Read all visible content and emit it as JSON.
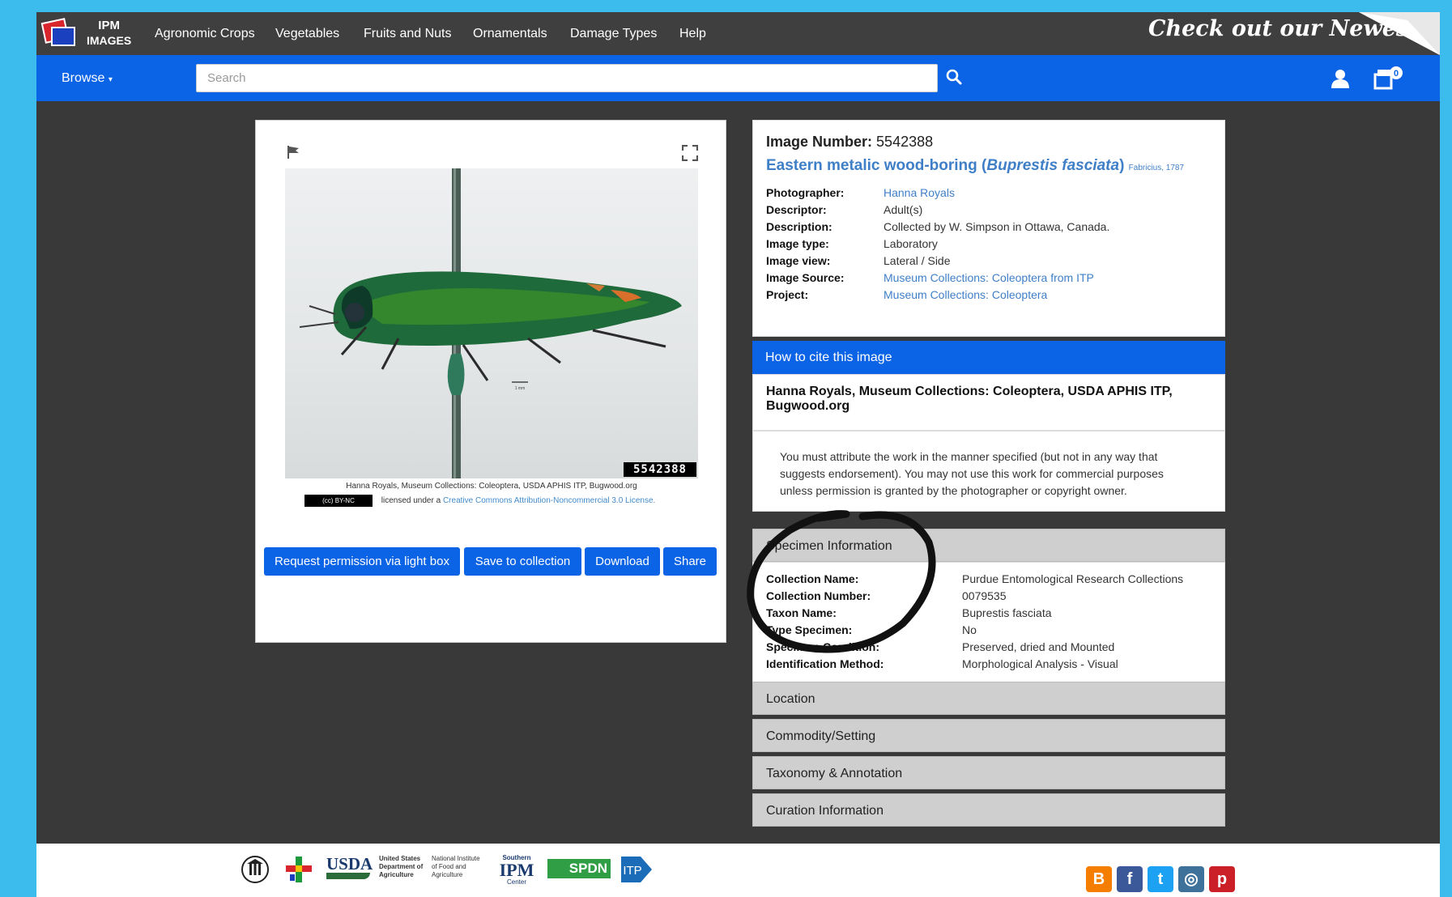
{
  "nav": {
    "logo_line1": "IPM",
    "logo_line2": "IMAGES",
    "links": [
      "Agronomic Crops",
      "Vegetables",
      "Fruits and Nuts",
      "Ornamentals",
      "Damage Types",
      "Help"
    ],
    "features_banner": "Check out our Newest Features"
  },
  "searchbar": {
    "browse_label": "Browse",
    "placeholder": "Search",
    "cart_count": "0"
  },
  "image": {
    "number_overlay": "5542388",
    "caption": "Hanna Royals, Museum Collections: Coleoptera, USDA APHIS ITP, Bugwood.org",
    "license_badge": "(cc) BY-NC",
    "license_prefix": "licensed under a",
    "license_link": "Creative Commons Attribution-Noncommercial 3.0 License.",
    "scale_label": "1 mm"
  },
  "actions": {
    "request": "Request permission via light box",
    "save": "Save to collection",
    "download": "Download",
    "share": "Share"
  },
  "info": {
    "number_label": "Image Number:",
    "number": "5542388",
    "title_common": "Eastern metalic wood-boring (",
    "title_sci": "Buprestis fasciata",
    "title_close": ")",
    "title_author": "Fabricius, 1787",
    "rows": [
      {
        "k": "Photographer:",
        "v": "Hanna Royals"
      },
      {
        "k": "Descriptor:",
        "v": "Adult(s)"
      },
      {
        "k": "Description:",
        "v": "Collected by W. Simpson in Ottawa, Canada."
      },
      {
        "k": "Image type:",
        "v": "Laboratory"
      },
      {
        "k": "Image view:",
        "v": "Lateral / Side"
      },
      {
        "k": "Image Source:",
        "v": "Museum Collections: Coleoptera from ITP"
      },
      {
        "k": "Project:",
        "v": "Museum Collections: Coleoptera"
      }
    ]
  },
  "cite": {
    "heading": "How to cite this image",
    "citation": "Hanna Royals, Museum Collections: Coleoptera, USDA APHIS ITP, Bugwood.org",
    "note": "You must attribute the work in the manner specified (but not in any way that suggests endorsement). You may not use this work for commercial purposes unless permission is granted by the photographer or copyright owner."
  },
  "specimen": {
    "heading": "Specimen Information",
    "rows": [
      {
        "k": "Collection Name:",
        "v": "Purdue Entomological Research Collections"
      },
      {
        "k": "Collection Number:",
        "v": "0079535"
      },
      {
        "k": "Taxon Name:",
        "v": "Buprestis fasciata"
      },
      {
        "k": "Type Specimen:",
        "v": "No"
      },
      {
        "k": "Specimen Condition:",
        "v": "Preserved, dried and Mounted"
      },
      {
        "k": "Identification Method:",
        "v": "Morphological Analysis - Visual"
      }
    ]
  },
  "accordions": [
    "Location",
    "Commodity/Setting",
    "Taxonomy & Annotation",
    "Curation Information"
  ],
  "footer": {
    "usda": "USDA",
    "usda_sub": "United States Department of Agriculture",
    "nifa": "National Institute of Food and Agriculture",
    "ipm_top": "Southern",
    "ipm": "IPM",
    "ipm_bottom": "Center",
    "spdn": "SPDN",
    "itp": "ITP"
  },
  "colors": {
    "nav_bg": "#3f3f3f",
    "accent": "#0b63e5",
    "link": "#3f7fc8",
    "page_bg": "#393939",
    "outer_bg": "#3cbcec"
  }
}
